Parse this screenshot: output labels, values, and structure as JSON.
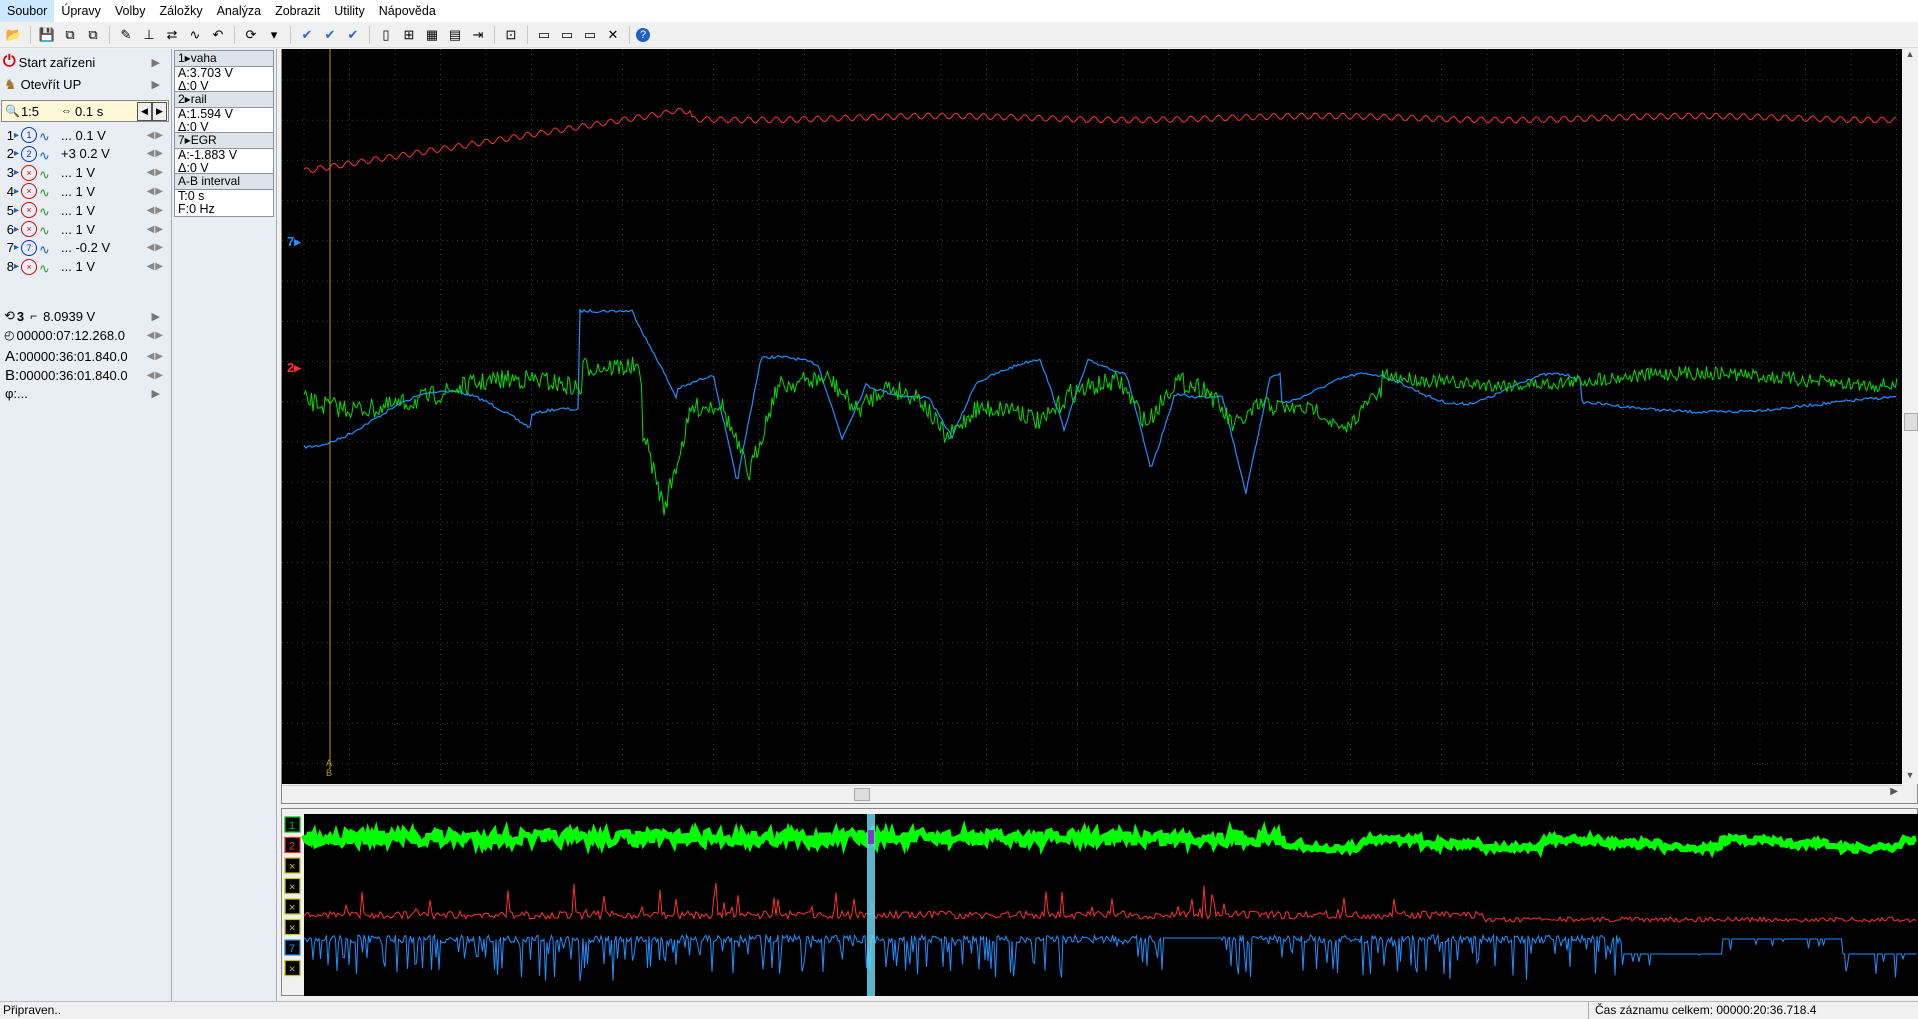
{
  "menu": [
    "Soubor",
    "Úpravy",
    "Volby",
    "Záložky",
    "Analýza",
    "Zobrazit",
    "Utility",
    "Nápověda"
  ],
  "toolbar_icons": [
    "open-icon",
    "save-icon",
    "copy-icon",
    "paste-icon",
    "wizard-icon",
    "cursor-icon",
    "measure-icon",
    "wave-icon",
    "undo-icon",
    "trigger-icon",
    "stop-icon",
    "check-icon",
    "check-down-icon",
    "check-double-icon",
    "page-icon",
    "zoom-fit-icon",
    "grid-icon",
    "folder-icon",
    "play-step-icon",
    "record-icon",
    "display-icon",
    "window-icon",
    "window2-icon",
    "close-window-icon",
    "help-icon"
  ],
  "left": {
    "start_label": "Start zařízeni",
    "open_label": "Otevřít UP",
    "zoom": {
      "ratio": "1:5",
      "time": "0.1 s"
    },
    "channels": [
      {
        "num": "1",
        "ic": "1",
        "val": "... 0.1 V",
        "state": "on"
      },
      {
        "num": "2",
        "ic": "2",
        "val": "+3 0.2 V",
        "state": "on"
      },
      {
        "num": "3",
        "ic": "×",
        "val": "... 1 V",
        "state": "off"
      },
      {
        "num": "4",
        "ic": "×",
        "val": "... 1 V",
        "state": "off"
      },
      {
        "num": "5",
        "ic": "×",
        "val": "... 1 V",
        "state": "off"
      },
      {
        "num": "6",
        "ic": "×",
        "val": "... 1 V",
        "state": "off"
      },
      {
        "num": "7",
        "ic": "7",
        "val": "... -0.2 V",
        "state": "on"
      },
      {
        "num": "8",
        "ic": "×",
        "val": "... 1 V",
        "state": "off"
      }
    ],
    "trigger": {
      "channel": "3",
      "level": "8.0939 V"
    },
    "record_time": "00000:07:12.268.0",
    "cursor_a": {
      "label": "A:",
      "value": "00000:36:01.840.0"
    },
    "cursor_b": {
      "label": "B:",
      "value": "00000:36:01.840.0"
    },
    "phi": {
      "label": "φ:",
      "value": "..."
    }
  },
  "measurements": [
    {
      "title": "1▸vaha",
      "l1": "A:3.703 V",
      "l2": "Δ:0 V"
    },
    {
      "title": "2▸rail",
      "l1": "A:1.594 V",
      "l2": "Δ:0 V"
    },
    {
      "title": "7▸EGR",
      "l1": "A:-1.883 V",
      "l2": "Δ:0 V"
    },
    {
      "title": "A-B interval",
      "l1": "T:0 s",
      "l2": "F:0 Hz"
    }
  ],
  "markers": {
    "ch7": "7▸",
    "ch2": "2▸",
    "cursor_a": "A",
    "cursor_b": "B"
  },
  "overview_channels": [
    "1",
    "2",
    "×",
    "×",
    "×",
    "×",
    "7",
    "×"
  ],
  "status": {
    "left": "Připraven..",
    "right": "Čas záznamu celkem: 00000:20:36.718.4"
  },
  "colors": {
    "ch1": "#00e000",
    "ch2": "#ff3030",
    "ch7": "#1e8fff",
    "cursor": "#b8a000",
    "scope_bg": "#000000"
  }
}
